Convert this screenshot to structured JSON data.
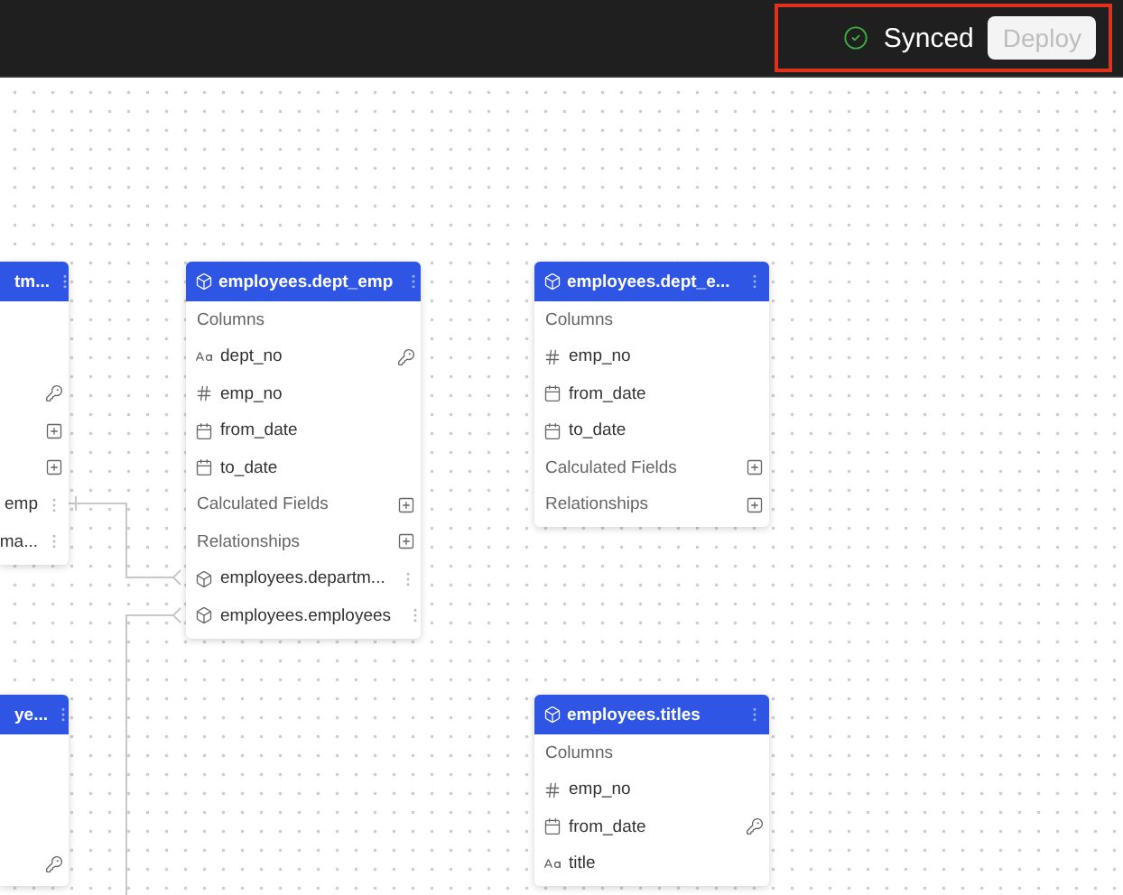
{
  "top_bar": {
    "sync_status": "Synced",
    "synced": true,
    "deploy_button": {
      "label": "Deploy",
      "disabled": true
    }
  },
  "models": [
    {
      "title": "tm...",
      "partial": true,
      "rows": [
        {
          "kind": "section"
        },
        {
          "kind": "column"
        },
        {
          "kind": "column",
          "primary_key": true
        },
        {
          "kind": "section",
          "addable": true
        },
        {
          "kind": "section",
          "addable": true
        },
        {
          "kind": "relation",
          "label": "emp"
        },
        {
          "kind": "relation",
          "label": "ma..."
        }
      ]
    },
    {
      "title": "employees.dept_emp",
      "partial": false,
      "rows": [
        {
          "kind": "section",
          "label": "Columns"
        },
        {
          "kind": "text",
          "label": "dept_no",
          "primary_key": true
        },
        {
          "kind": "number",
          "label": "emp_no"
        },
        {
          "kind": "date",
          "label": "from_date"
        },
        {
          "kind": "date",
          "label": "to_date"
        },
        {
          "kind": "section",
          "label": "Calculated Fields",
          "addable": true
        },
        {
          "kind": "section",
          "label": "Relationships",
          "addable": true
        },
        {
          "kind": "relation",
          "label": "employees.departm..."
        },
        {
          "kind": "relation",
          "label": "employees.employees"
        }
      ]
    },
    {
      "title": "employees.dept_e...",
      "partial": false,
      "rows": [
        {
          "kind": "section",
          "label": "Columns"
        },
        {
          "kind": "number",
          "label": "emp_no"
        },
        {
          "kind": "date",
          "label": "from_date"
        },
        {
          "kind": "date",
          "label": "to_date"
        },
        {
          "kind": "section",
          "label": "Calculated Fields",
          "addable": true
        },
        {
          "kind": "section",
          "label": "Relationships",
          "addable": true
        }
      ]
    },
    {
      "title": "ye...",
      "partial": true,
      "rows": [
        {
          "kind": "section"
        },
        {
          "kind": "column"
        },
        {
          "kind": "column"
        },
        {
          "kind": "column",
          "primary_key": true
        }
      ]
    },
    {
      "title": "employees.titles",
      "partial": false,
      "rows": [
        {
          "kind": "section",
          "label": "Columns"
        },
        {
          "kind": "number",
          "label": "emp_no"
        },
        {
          "kind": "date",
          "label": "from_date",
          "primary_key": true
        },
        {
          "kind": "text",
          "label": "title"
        }
      ]
    }
  ]
}
